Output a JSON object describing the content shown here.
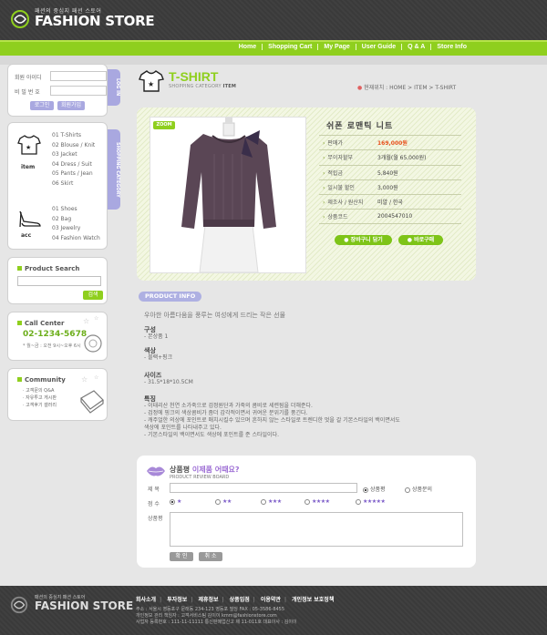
{
  "header": {
    "logo_sub": "패션의 중심지 패션 스토어",
    "logo_main": "FASHION STORE",
    "nav": [
      "Home",
      "Shopping Cart",
      "My Page",
      "User Guide",
      "Q & A",
      "Store Info"
    ]
  },
  "login": {
    "id_label": "회원 아이디",
    "pw_label": "비 밀 번 호",
    "login_button": "로그인",
    "join_button": "회원가입",
    "tab_label": "LOG IN"
  },
  "category": {
    "tab_label": "SHOPPING CATEGORY",
    "item_label": "item",
    "item_list": [
      "01 T-Shirts",
      "02 Blouse / Knit",
      "03 Jacket",
      "04 Dress / Suit",
      "05 Pants / Jean",
      "06 Skirt"
    ],
    "acc_label": "acc",
    "acc_list": [
      "01 Shoes",
      "02 Bag",
      "03 Jewelry",
      "04 Fashion Watch"
    ]
  },
  "search": {
    "title": "Product Search",
    "button": "검색"
  },
  "call": {
    "title": "Call Center",
    "phone": "02-1234-5678",
    "hours": "* 월~금 : 오전 9시~오후 6시"
  },
  "community": {
    "title": "Community",
    "items": [
      "· 고객문의 Q&A",
      "· 자유투고 게시판",
      "· 고객후기 갤러리"
    ]
  },
  "page": {
    "title": "T-SHIRT",
    "sub_prefix": "SHOPPING CATEGORY",
    "sub_bold": "ITEM",
    "breadcrumb": "현재위치 : HOME > ITEM > T-SHIRT"
  },
  "product": {
    "zoom": "ZOOM",
    "name": "쉬폰 로맨틱 니트",
    "specs": [
      {
        "k": "판매가",
        "v": "169,000원"
      },
      {
        "k": "무이자할부",
        "v": "3개월(월 65,000원)"
      },
      {
        "k": "적립금",
        "v": "5,840원"
      },
      {
        "k": "일시불 할인",
        "v": "3,000원"
      },
      {
        "k": "제조사 / 원산지",
        "v": "미얄 / 한국"
      },
      {
        "k": "상품코드",
        "v": "2004547010"
      }
    ],
    "cart_button": "장바구니 담기",
    "buy_button": "바로구매"
  },
  "info": {
    "tag": "PRODUCT INFO",
    "intro": "우아한 아름다움을 풍루는 여성에게 드리는 작은 선물",
    "sections": [
      {
        "h": "구성",
        "lines": [
          "- 본상품 1"
        ]
      },
      {
        "h": "색상",
        "lines": [
          "- 블랙+핑크"
        ]
      },
      {
        "h": "사이즈",
        "lines": [
          "- 31.5*18*10.5CM"
        ]
      },
      {
        "h": "특징",
        "lines": [
          "- 이태리산 천연 소가죽으로 검정원단과 가죽의 콤비로 세련됨을 더해준다.",
          "- 검정에 핑크의 색상콤비가 좀더 감각적이면서 귀여운 분위기를 풍긴다.",
          "- 캐주얼한 의상에 포인트로 매치시킬수 있으며 흔하지 않는 스타일로 트렌디한 멋을 갈 기본스타일의 백이면서도",
          "  색상에 포인트를 나타내주고 있다.",
          "- 기본스타일의 백이면서도 색상에 포인트를 준 스타일이다."
        ]
      }
    ]
  },
  "review": {
    "title": "상품평",
    "title_em": "이제품 어때요?",
    "sub": "PRODUCT REVIEW BOARD",
    "subject_label": "제 목",
    "score_label": "점 수",
    "body_label": "상품평",
    "type_opts": [
      "상품평",
      "상품문의"
    ],
    "scores": [
      "★",
      "★★",
      "★★★",
      "★★★★",
      "★★★★★"
    ],
    "ok_button": "확 인",
    "cancel_button": "취 소"
  },
  "footer": {
    "logo_sub": "패션의 중심지 패션 스토어",
    "logo_main": "FASHION STORE",
    "links": [
      "회사소개",
      "투자정보",
      "제휴정보",
      "상품입점",
      "이용약관",
      "개인정보 보호정책"
    ],
    "addr1": "주소 : 서울시 영등포구 문래동 234-123 영등포 빌딩   FAX : 05-3586-8455",
    "addr2": "개인정보 관리 책임자 : 고객서비스팀 김이이   kmm@fashionstore.com",
    "addr3": "사업자 등록번호 : 111-11-11111  통신판매업신고 제 11-011호  대표이사 : 김이이"
  }
}
